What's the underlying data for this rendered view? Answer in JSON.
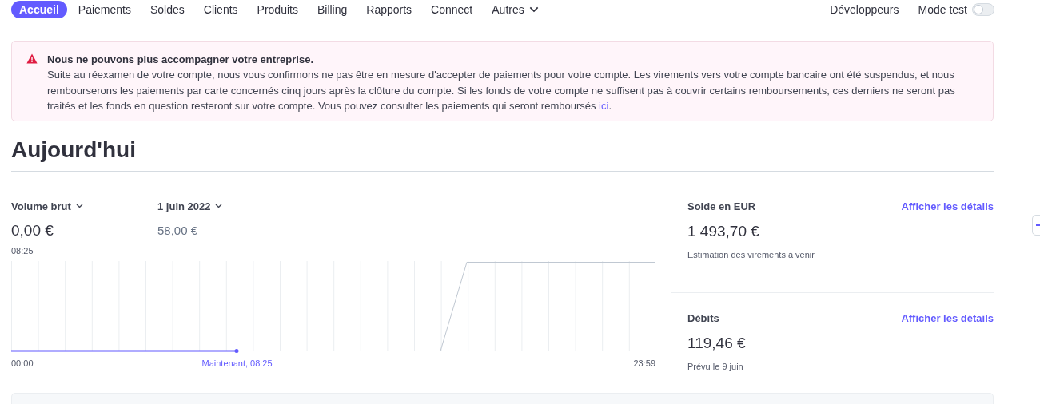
{
  "nav": {
    "items": [
      {
        "label": "Accueil",
        "selected": true,
        "dropdown": false
      },
      {
        "label": "Paiements",
        "selected": false,
        "dropdown": false
      },
      {
        "label": "Soldes",
        "selected": false,
        "dropdown": false
      },
      {
        "label": "Clients",
        "selected": false,
        "dropdown": false
      },
      {
        "label": "Produits",
        "selected": false,
        "dropdown": false
      },
      {
        "label": "Billing",
        "selected": false,
        "dropdown": false
      },
      {
        "label": "Rapports",
        "selected": false,
        "dropdown": false
      },
      {
        "label": "Connect",
        "selected": false,
        "dropdown": false
      },
      {
        "label": "Autres",
        "selected": false,
        "dropdown": true
      }
    ],
    "developers": "Développeurs",
    "test_mode": {
      "label": "Mode test",
      "on": false
    }
  },
  "alert": {
    "title": "Nous ne pouvons plus accompagner votre entreprise.",
    "body": "Suite au réexamen de votre compte, nous vous confirmons ne pas être en mesure d'accepter de paiements pour votre compte. Les virements vers votre compte bancaire ont été suspendus, et nous rembourserons les paiements par carte concernés cinq jours après la clôture du compte. Si les fonds de votre compte ne suffisent pas à couvrir certains remboursements, ces derniers ne seront pas traités et les fonds en question resteront sur votre compte. Vous pouvez consulter les paiements qui seront remboursés",
    "link": "ici",
    "end": "."
  },
  "heading": "Aujourd'hui",
  "volume": {
    "metric": "Volume brut",
    "value": "0,00 €",
    "time": "08:25",
    "compare_date": "1 juin 2022",
    "compare_value": "58,00 €",
    "axis_start": "00:00",
    "now_label": "Maintenant, 08:25",
    "axis_end": "23:59"
  },
  "balances": [
    {
      "title": "Solde en EUR",
      "link": "Afficher les détails",
      "amount": "1 493,70 €",
      "note": "Estimation des virements à venir"
    },
    {
      "title": "Débits",
      "link": "Afficher les détails",
      "amount": "119,46 €",
      "note": "Prévu le 9 juin"
    }
  ]
}
